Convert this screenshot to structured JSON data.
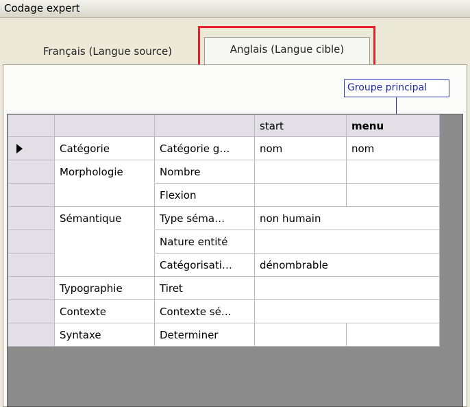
{
  "window": {
    "title": "Codage expert"
  },
  "tabs": [
    {
      "label": "Français (Langue source)",
      "active": false
    },
    {
      "label": "Anglais (Langue cible)",
      "active": true
    }
  ],
  "group_label": "Groupe principal",
  "grid": {
    "columns": [
      "",
      "",
      "",
      "start",
      "menu"
    ],
    "rows": [
      {
        "category": "Catégorie",
        "property": "Catégorie g…",
        "start": "nom",
        "menu": "nom",
        "current": true
      },
      {
        "category": "Morphologie",
        "property": "Nombre",
        "start": "",
        "menu": ""
      },
      {
        "category": "",
        "property": "Flexion",
        "start": "",
        "menu": ""
      },
      {
        "category": "Sémantique",
        "property": "Type séma…",
        "start": "non humain",
        "menu": ""
      },
      {
        "category": "",
        "property": "Nature entité",
        "start": "",
        "menu": ""
      },
      {
        "category": "",
        "property": "Catégorisati…",
        "start": "dénombrable",
        "menu": ""
      },
      {
        "category": "Typographie",
        "property": "Tiret",
        "start": "",
        "menu": ""
      },
      {
        "category": "Contexte",
        "property": "Contexte sé…",
        "start": "",
        "menu": ""
      },
      {
        "category": "Syntaxe",
        "property": "Determiner",
        "start": "",
        "menu": ""
      }
    ]
  },
  "colors": {
    "highlight": "#e8202a",
    "group_label": "#1c2aa0",
    "grid_header": "#e3dfe6"
  }
}
